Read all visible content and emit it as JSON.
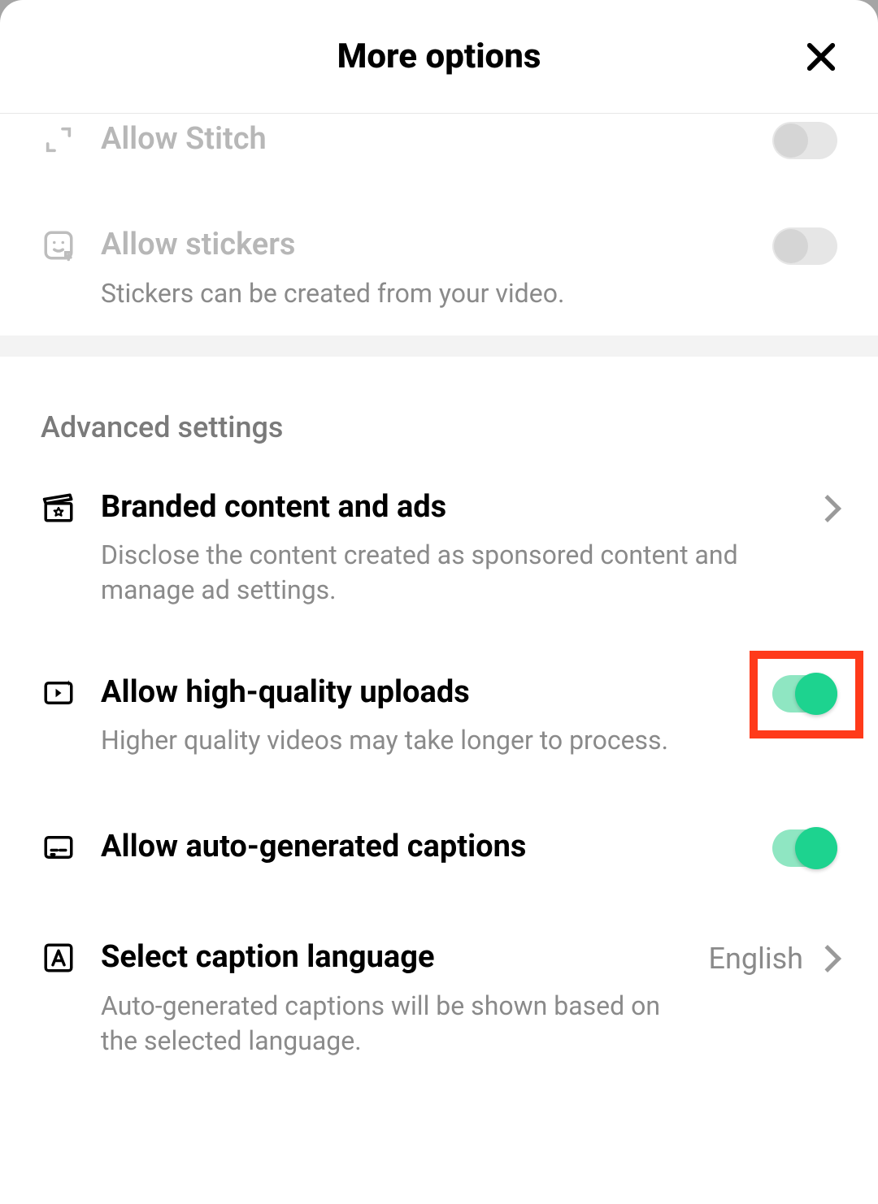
{
  "header": {
    "title": "More options"
  },
  "rows": {
    "stitch": {
      "title": "Allow Stitch"
    },
    "stickers": {
      "title": "Allow stickers",
      "sub": "Stickers can be created from your video."
    },
    "branded": {
      "title": "Branded content and ads",
      "sub": "Disclose the content created as sponsored content and manage ad settings."
    },
    "hq": {
      "title": "Allow high-quality uploads",
      "sub": "Higher quality videos may take longer to process."
    },
    "captions": {
      "title": "Allow auto-generated captions"
    },
    "lang": {
      "title": "Select caption language",
      "value": "English",
      "sub": "Auto-generated captions will be shown based on the selected language."
    }
  },
  "sections": {
    "advanced": "Advanced settings"
  }
}
